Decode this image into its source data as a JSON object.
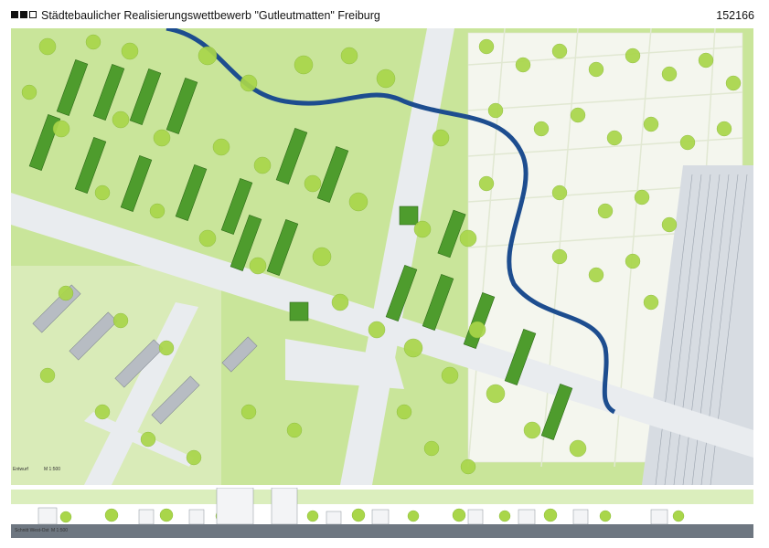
{
  "header": {
    "title": "Städtebaulicher Realisierungswettbewerb \"Gutleutmatten\" Freiburg",
    "number": "152166"
  },
  "plan": {
    "label": "Entwurf",
    "scale": "M 1:500"
  },
  "section": {
    "label": "Schnitt West-Ost",
    "scale": "M 1:500"
  },
  "colors": {
    "lawn": "#c9e59a",
    "tree": "#a9d64a",
    "building": "#4e9c2d",
    "water": "#1d4d8f",
    "road": "#e9ecef",
    "rail": "#d7dce2"
  },
  "icons": [
    "tree-canopy",
    "building-block",
    "water-channel",
    "road",
    "railway"
  ]
}
